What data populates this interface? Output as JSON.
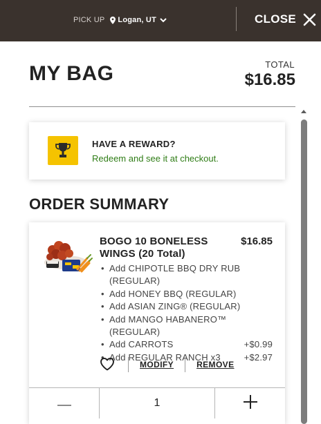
{
  "header": {
    "pickup_label": "PICK UP",
    "location": "Logan, UT",
    "close_label": "CLOSE"
  },
  "bag": {
    "title": "MY BAG",
    "total_label": "TOTAL",
    "total_value": "$16.85"
  },
  "reward": {
    "title": "HAVE A REWARD?",
    "subtitle": "Redeem and see it at checkout."
  },
  "order_summary": {
    "title": "ORDER SUMMARY",
    "items": [
      {
        "name": "BOGO 10 BONELESS WINGS (20 Total)",
        "price": "$16.85",
        "modifiers": [
          {
            "text": "Add CHIPOTLE BBQ DRY RUB (REGULAR)",
            "price": ""
          },
          {
            "text": "Add HONEY BBQ (REGULAR)",
            "price": ""
          },
          {
            "text": "Add ASIAN ZING® (REGULAR)",
            "price": ""
          },
          {
            "text": "Add MANGO HABANERO™ (REGULAR)",
            "price": ""
          },
          {
            "text": "Add CARROTS",
            "price": "+$0.99"
          },
          {
            "text": "Add REGULAR RANCH x3",
            "price": "+$2.97"
          }
        ],
        "modify_label": "MODIFY",
        "remove_label": "REMOVE",
        "quantity": "1"
      }
    ]
  },
  "colors": {
    "header_bg": "#3a322d",
    "reward_badge": "#f5c300",
    "reward_link": "#2f7d16"
  },
  "icons": {
    "pin": "location-pin-icon",
    "chevron": "chevron-down-icon",
    "close": "close-icon",
    "trophy": "trophy-icon",
    "heart": "heart-outline-icon",
    "minus": "minus-icon",
    "plus": "plus-icon"
  }
}
